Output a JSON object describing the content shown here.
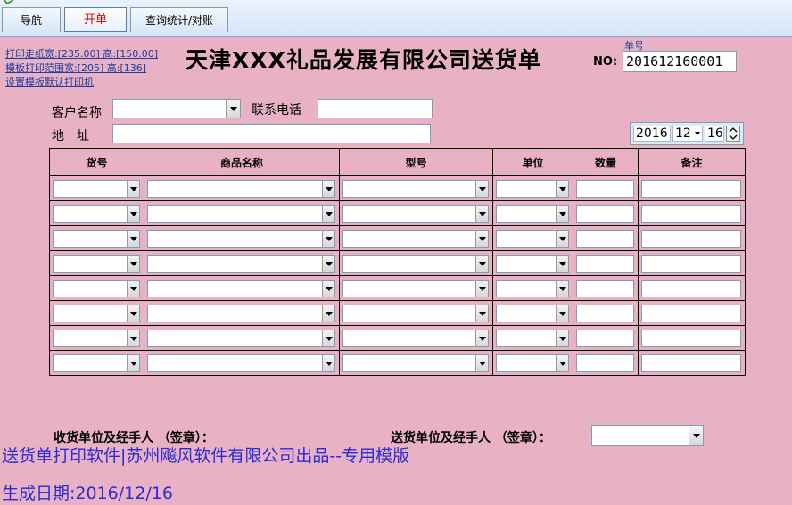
{
  "tabs": [
    {
      "label": "导航"
    },
    {
      "label": "开单",
      "active": true
    },
    {
      "label": "查询统计/对账"
    }
  ],
  "side_links": [
    "打印走纸宽:[235.00] 高:[150.00]",
    "模板打印范围宽:[205] 高:[136]",
    "设置模板默认打印机"
  ],
  "form": {
    "title": "天津XXX礼品发展有限公司送货单",
    "no_caption": "单号",
    "no_label": "NO:",
    "no_value": "201612160001",
    "customer_label": "客户名称",
    "customer_value": "",
    "phone_label": "联系电话",
    "phone_value": "",
    "address_label": "地　址",
    "address_value": "",
    "date": {
      "year": "2016",
      "month": "12",
      "day": "16"
    }
  },
  "table": {
    "columns": [
      "货号",
      "商品名称",
      "型号",
      "单位",
      "数量",
      "备注"
    ],
    "row_count": 8
  },
  "signatures": {
    "receiver": "收货单位及经手人 （签章）：",
    "sender": "送货单位及经手人 （签章）：",
    "sender_value": ""
  },
  "footer": {
    "credit": "送货单打印软件|苏州飚风软件有限公司出品--专用模版",
    "date_line": "生成日期:2016/12/16"
  },
  "colors": {
    "background": "#e8b2c4",
    "footer_text": "#2b2bd6",
    "active_tab_text": "#d40000",
    "link_text": "#1f3c9e"
  }
}
